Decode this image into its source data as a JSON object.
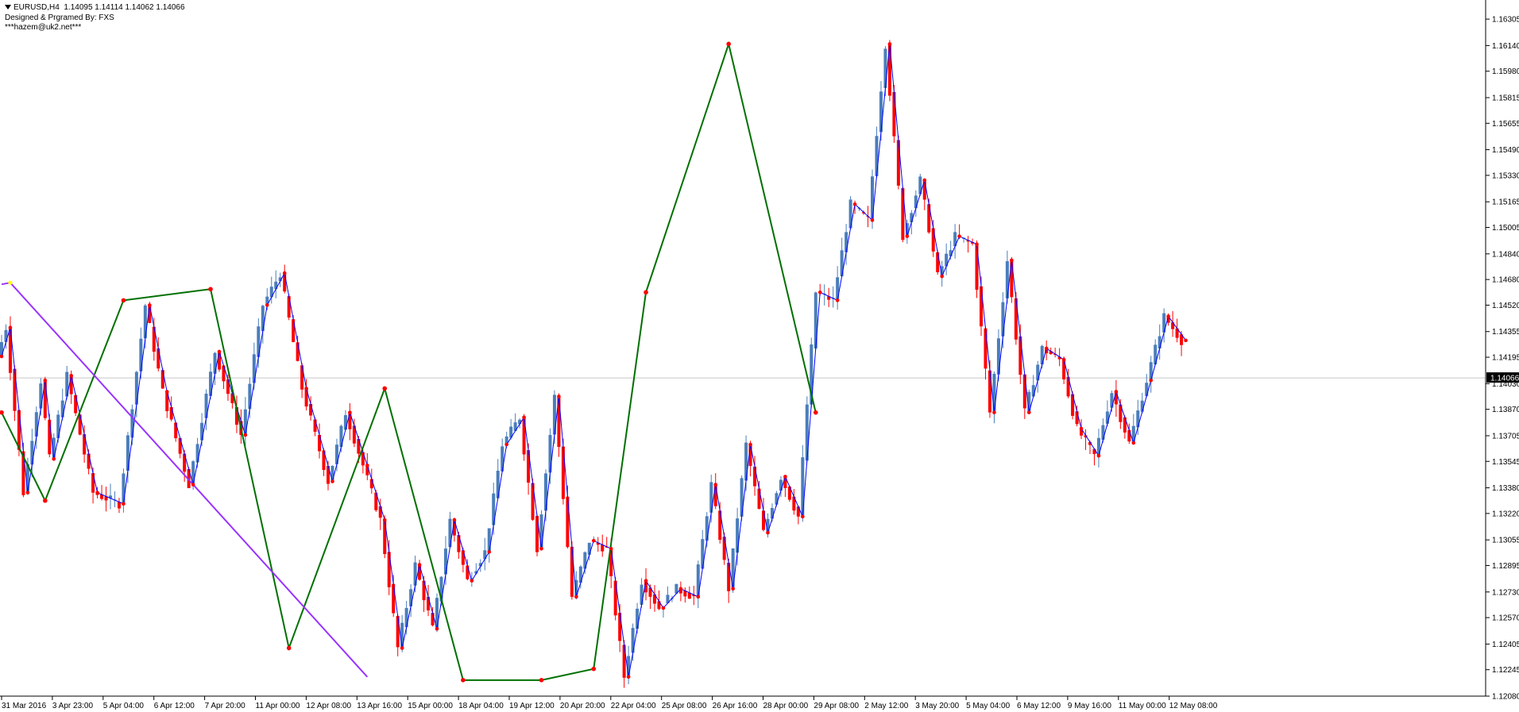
{
  "header": {
    "symbol": "EURUSD,H4",
    "ohlc": "1.14095 1.14114 1.14062 1.14066",
    "credit": "Designed & Prgramed By: FXS",
    "email": "***hazem@uk2.net***"
  },
  "colors": {
    "bull": "#4a7ebb",
    "bear": "#ff0000",
    "zigzag_minor": "#0000ff",
    "zigzag_major": "#007000",
    "trendline": "#9933ff",
    "pivot_dot": "#ff0000",
    "current_price_line": "#c8c8c8",
    "price_tag": "#000000"
  },
  "chart_data": {
    "type": "candlestick",
    "symbol": "EURUSD",
    "timeframe": "H4",
    "y_ticks": [
      "1.16305",
      "1.16140",
      "1.15980",
      "1.15815",
      "1.15655",
      "1.15490",
      "1.15330",
      "1.15165",
      "1.15005",
      "1.14840",
      "1.14680",
      "1.14520",
      "1.14355",
      "1.14195",
      "1.14030",
      "1.13870",
      "1.13705",
      "1.13545",
      "1.13380",
      "1.13220",
      "1.13055",
      "1.12895",
      "1.12730",
      "1.12570",
      "1.12405",
      "1.12245",
      "1.12080"
    ],
    "ylim": [
      1.1208,
      1.1635
    ],
    "current_price": "1.14066",
    "x_ticks": [
      "31 Mar 2016",
      "3 Apr 23:00",
      "5 Apr 04:00",
      "6 Apr 12:00",
      "7 Apr 20:00",
      "11 Apr 00:00",
      "12 Apr 08:00",
      "13 Apr 16:00",
      "15 Apr 00:00",
      "18 Apr 04:00",
      "19 Apr 12:00",
      "20 Apr 20:00",
      "22 Apr 04:00",
      "25 Apr 08:00",
      "26 Apr 16:00",
      "28 Apr 00:00",
      "29 Apr 08:00",
      "2 May 12:00",
      "3 May 20:00",
      "5 May 04:00",
      "6 May 12:00",
      "9 May 16:00",
      "11 May 00:00",
      "12 May 08:00"
    ],
    "zigzag_minor": [
      [
        0,
        1.142
      ],
      [
        2,
        1.1438
      ],
      [
        6,
        1.1335
      ],
      [
        10,
        1.1405
      ],
      [
        12,
        1.1356
      ],
      [
        16,
        1.1408
      ],
      [
        22,
        1.1335
      ],
      [
        28,
        1.1328
      ],
      [
        34,
        1.1452
      ],
      [
        38,
        1.1398
      ],
      [
        44,
        1.134
      ],
      [
        50,
        1.1423
      ],
      [
        56,
        1.1371
      ],
      [
        61,
        1.1452
      ],
      [
        65,
        1.1472
      ],
      [
        70,
        1.14
      ],
      [
        76,
        1.1342
      ],
      [
        80,
        1.1385
      ],
      [
        84,
        1.1352
      ],
      [
        88,
        1.1318
      ],
      [
        92,
        1.1238
      ],
      [
        96,
        1.129
      ],
      [
        100,
        1.125
      ],
      [
        104,
        1.1318
      ],
      [
        108,
        1.128
      ],
      [
        112,
        1.1298
      ],
      [
        116,
        1.1365
      ],
      [
        120,
        1.1382
      ],
      [
        124,
        1.13
      ],
      [
        128,
        1.1395
      ],
      [
        132,
        1.127
      ],
      [
        136,
        1.1305
      ],
      [
        140,
        1.13
      ],
      [
        144,
        1.122
      ],
      [
        148,
        1.128
      ],
      [
        152,
        1.1263
      ],
      [
        156,
        1.1275
      ],
      [
        160,
        1.127
      ],
      [
        164,
        1.134
      ],
      [
        168,
        1.1275
      ],
      [
        172,
        1.1365
      ],
      [
        176,
        1.131
      ],
      [
        180,
        1.1345
      ],
      [
        184,
        1.132
      ],
      [
        188,
        1.146
      ],
      [
        192,
        1.1455
      ],
      [
        196,
        1.1515
      ],
      [
        200,
        1.1505
      ],
      [
        204,
        1.1615
      ],
      [
        208,
        1.1495
      ],
      [
        212,
        1.153
      ],
      [
        216,
        1.147
      ],
      [
        220,
        1.1495
      ],
      [
        224,
        1.149
      ],
      [
        228,
        1.1385
      ],
      [
        232,
        1.148
      ],
      [
        236,
        1.1385
      ],
      [
        240,
        1.1425
      ],
      [
        244,
        1.1418
      ],
      [
        248,
        1.1375
      ],
      [
        252,
        1.1358
      ],
      [
        256,
        1.1398
      ],
      [
        260,
        1.1366
      ],
      [
        264,
        1.1405
      ],
      [
        268,
        1.1445
      ],
      [
        272,
        1.143
      ]
    ],
    "zigzag_major": [
      [
        0,
        1.1385
      ],
      [
        10,
        1.133
      ],
      [
        28,
        1.1455
      ],
      [
        48,
        1.1462
      ],
      [
        66,
        1.1238
      ],
      [
        88,
        1.14
      ],
      [
        106,
        1.1218
      ],
      [
        124,
        1.1218
      ],
      [
        136,
        1.1225
      ],
      [
        148,
        1.146
      ],
      [
        167,
        1.1615
      ],
      [
        187,
        1.1385
      ]
    ],
    "trendline": [
      [
        0,
        1.1465
      ],
      [
        2,
        1.1466
      ],
      [
        84,
        1.122
      ]
    ],
    "pivot_markers": [
      [
        2,
        1.1466,
        "yellow"
      ]
    ]
  }
}
